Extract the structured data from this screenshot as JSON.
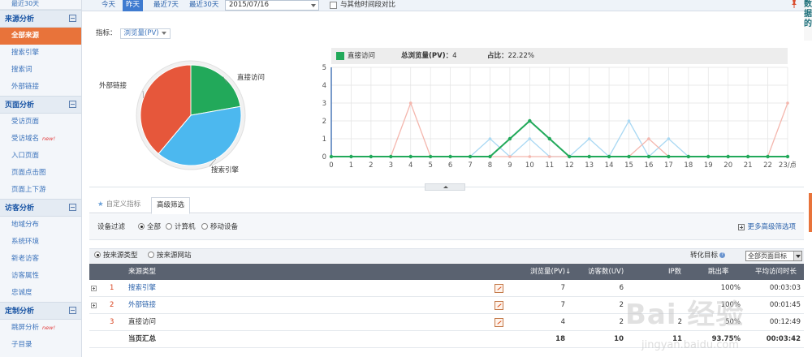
{
  "sidebar": {
    "top_link": "最近30天",
    "groups": [
      {
        "title": "来源分析",
        "items": [
          "全部来源",
          "搜索引擎",
          "搜索词",
          "外部链接"
        ]
      },
      {
        "title": "页面分析",
        "items": [
          "受访页面",
          "受访域名",
          "入口页面",
          "页面点击图",
          "页面上下游"
        ]
      },
      {
        "title": "访客分析",
        "items": [
          "地域分布",
          "系统环境",
          "新老访客",
          "访客属性",
          "忠诚度"
        ]
      },
      {
        "title": "定制分析",
        "items": [
          "跳屏分析",
          "子目录"
        ]
      }
    ],
    "new_badge": "new!"
  },
  "toolbar": {
    "today": "今天",
    "yesterday": "昨天",
    "last7": "最近7天",
    "last30": "最近30天",
    "date_value": "2015/07/16",
    "compare_label": "与其他时间段对比"
  },
  "right_edge_text": "数据的",
  "indicator": {
    "label": "指标：",
    "value": "浏览量(PV)"
  },
  "pie": {
    "slices": [
      {
        "label": "直接访问",
        "value": 4,
        "color": "#22a95a"
      },
      {
        "label": "搜索引擎",
        "value": 7,
        "color": "#4cb8ef"
      },
      {
        "label": "外部链接",
        "value": 7,
        "color": "#e6573b"
      }
    ]
  },
  "legend": {
    "series_name": "直接访问",
    "total_label": "总浏览量(PV)：",
    "total_value": "4",
    "ratio_label": "占比：",
    "ratio_value": "22.22%"
  },
  "chart_data": [
    {
      "type": "pie",
      "categories": [
        "直接访问",
        "搜索引擎",
        "外部链接"
      ],
      "values": [
        4,
        7,
        7
      ]
    },
    {
      "type": "line",
      "x": [
        "0",
        "1",
        "2",
        "3",
        "4",
        "5",
        "6",
        "7",
        "8",
        "9",
        "10",
        "11",
        "12",
        "13",
        "14",
        "15",
        "16",
        "17",
        "18",
        "19",
        "20",
        "21",
        "22",
        "23/点"
      ],
      "ylim": [
        0,
        5
      ],
      "yticks": [
        0,
        1,
        2,
        3,
        4,
        5
      ],
      "series": [
        {
          "name": "直接访问",
          "color": "#22a95a",
          "values": [
            0,
            0,
            0,
            0,
            0,
            0,
            0,
            0,
            0,
            1,
            2,
            1,
            0,
            0,
            0,
            0,
            0,
            0,
            0,
            0,
            0,
            0,
            0,
            0
          ]
        },
        {
          "color": "#f4b6ad",
          "values": [
            0,
            0,
            0,
            0,
            3,
            0,
            0,
            0,
            0,
            0,
            0,
            0,
            0,
            0,
            0,
            0,
            1,
            0,
            0,
            0,
            0,
            0,
            0,
            3
          ]
        },
        {
          "color": "#a9d8f3",
          "values": [
            0,
            0,
            0,
            0,
            0,
            0,
            0,
            0,
            1,
            0,
            1,
            0,
            0,
            1,
            0,
            2,
            0,
            1,
            0,
            0,
            0,
            0,
            0,
            0
          ]
        }
      ]
    }
  ],
  "tabs": {
    "custom": "自定义指标",
    "advanced": "高级筛选"
  },
  "filter": {
    "label": "设备过滤",
    "options": [
      "全部",
      "计算机",
      "移动设备"
    ],
    "more": "更多高级筛选项"
  },
  "source_switch": {
    "by_type": "按来源类型",
    "by_site": "按来源网站",
    "conversion_label": "转化目标",
    "conversion_value": "全部页面目标"
  },
  "table": {
    "headers": [
      "来源类型",
      "浏览量(PV)",
      "访客数(UV)",
      "IP数",
      "跳出率",
      "平均访问时长"
    ],
    "rows": [
      {
        "idx": "1",
        "name": "搜索引擎",
        "pv": "7",
        "uv": "6",
        "ip": "",
        "bounce": "100%",
        "dur": "00:03:03"
      },
      {
        "idx": "2",
        "name": "外部链接",
        "pv": "7",
        "uv": "2",
        "ip": "",
        "bounce": "100%",
        "dur": "00:01:45"
      },
      {
        "idx": "3",
        "name": "直接访问",
        "pv": "4",
        "uv": "2",
        "ip": "2",
        "bounce": "50%",
        "dur": "00:12:49"
      }
    ],
    "total": {
      "name": "当页汇总",
      "pv": "18",
      "uv": "10",
      "ip": "11",
      "bounce": "93.75%",
      "dur": "00:03:42"
    }
  },
  "watermark": {
    "main": "Bai 经验",
    "sub": "jingyan.baidu.com"
  }
}
